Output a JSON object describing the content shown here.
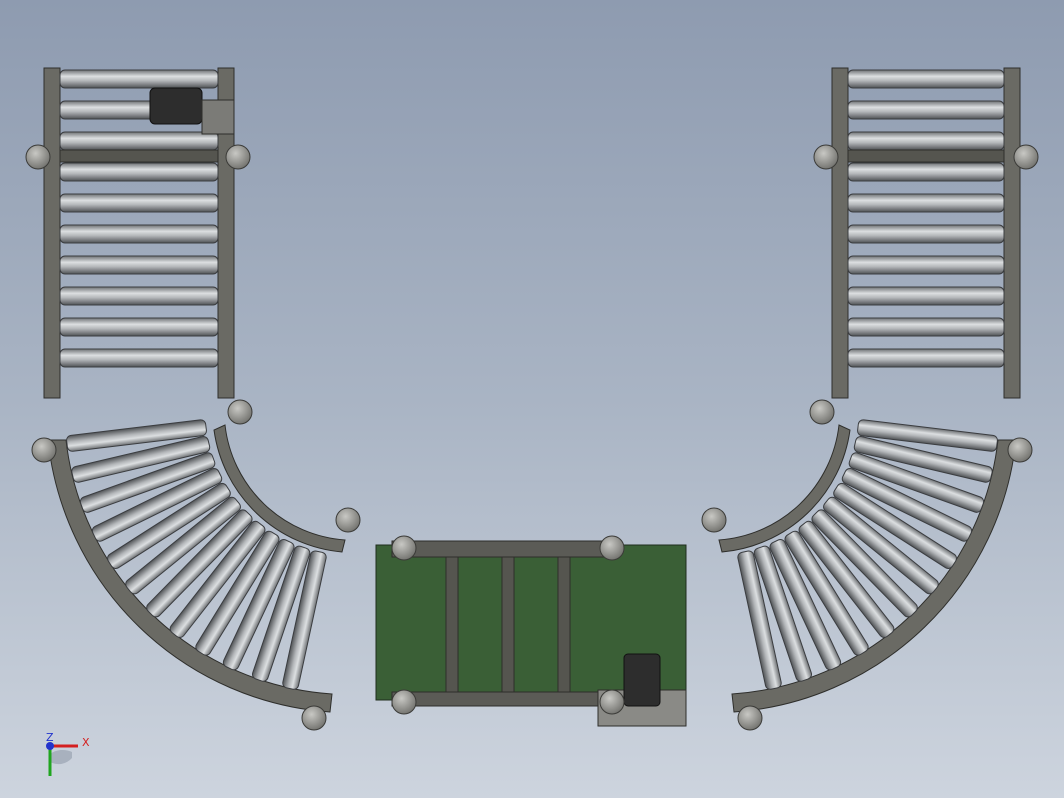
{
  "viewport": {
    "background_top": "#8e9bb0",
    "background_bottom": "#cdd4de"
  },
  "model": {
    "frame_color": "#5f5f5a",
    "frame_stroke": "#2e2e2b",
    "roller_color": "#b9bcbf",
    "belt_color": "#3a5f36",
    "motor_color": "#2d2d2d",
    "caster_color": "#9a9a97",
    "straight_roller_count": 10,
    "curve_roller_count": 12
  },
  "triad": {
    "x_label": "X",
    "z_label": "Z",
    "x_color": "#d42020",
    "y_color": "#1fa51f",
    "z_color": "#2233cc"
  }
}
